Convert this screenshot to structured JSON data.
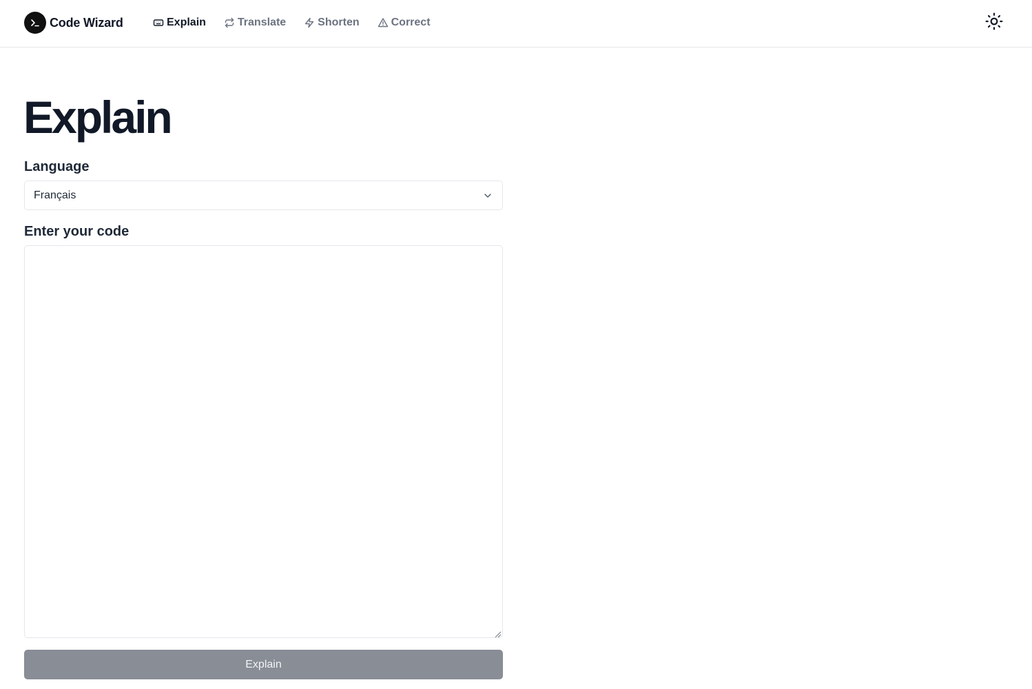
{
  "header": {
    "brand_name": "Code Wizard",
    "nav": [
      {
        "label": "Explain",
        "icon": "keyboard-icon",
        "active": true
      },
      {
        "label": "Translate",
        "icon": "repeat-icon",
        "active": false
      },
      {
        "label": "Shorten",
        "icon": "zap-icon",
        "active": false
      },
      {
        "label": "Correct",
        "icon": "alert-triangle-icon",
        "active": false
      }
    ],
    "theme_toggle_icon": "sun-icon"
  },
  "main": {
    "title": "Explain",
    "language_label": "Language",
    "language_value": "Français",
    "code_label": "Enter your code",
    "code_value": "",
    "submit_label": "Explain"
  },
  "colors": {
    "text_primary": "#111827",
    "text_muted": "#6b7280",
    "border": "#e5e7eb",
    "button_disabled": "#888d96"
  }
}
